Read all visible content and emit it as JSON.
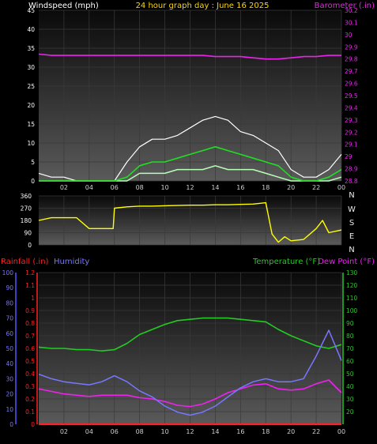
{
  "colors": {
    "background": "#000000",
    "wind": "#ffffff",
    "wind_avg": "#22dd22",
    "wind_low": "#b8ffb8",
    "barometer": "#ee22ee",
    "direction": "#ffff00",
    "temperature": "#22cc22",
    "dewpoint": "#ee22ee",
    "humidity": "#7777ff",
    "rainfall": "#ff2222",
    "title": "#ffd700"
  },
  "chart_data": [
    {
      "type": "line",
      "title": "24 hour graph day : June 16 2025",
      "left_label": "Windspeed (mph)",
      "right_label": "Barometer (.in)",
      "x_ticks": [
        "02",
        "04",
        "06",
        "08",
        "10",
        "12",
        "14",
        "16",
        "18",
        "20",
        "22",
        "00"
      ],
      "y_left": {
        "ticks": [
          0,
          5,
          10,
          15,
          20,
          25,
          30,
          35,
          40,
          45
        ],
        "range": [
          0,
          45
        ]
      },
      "y_right": {
        "ticks": [
          "28.8",
          "28.9",
          "29",
          "29.1",
          "29.2",
          "29.3",
          "29.4",
          "29.5",
          "29.6",
          "29.7",
          "29.8",
          "29.9",
          "30",
          "30.1",
          "30.2"
        ],
        "range": [
          28.8,
          30.2
        ]
      },
      "x_hours": [
        0,
        1,
        2,
        3,
        4,
        5,
        6,
        7,
        8,
        9,
        10,
        11,
        12,
        13,
        14,
        15,
        16,
        17,
        18,
        19,
        20,
        21,
        22,
        23,
        24
      ],
      "series": [
        {
          "name": "wind_gust",
          "values": [
            2,
            1,
            1,
            0,
            0,
            0,
            0,
            5,
            9,
            11,
            11,
            12,
            14,
            16,
            17,
            16,
            13,
            12,
            10,
            8,
            3,
            1,
            1,
            3,
            7
          ]
        },
        {
          "name": "wind_avg",
          "values": [
            0,
            0,
            0,
            0,
            0,
            0,
            0,
            1,
            4,
            5,
            5,
            6,
            7,
            8,
            9,
            8,
            7,
            6,
            5,
            4,
            1,
            0,
            0,
            1,
            3
          ]
        },
        {
          "name": "wind_low",
          "values": [
            0,
            0,
            0,
            0,
            0,
            0,
            0,
            0,
            2,
            2,
            2,
            3,
            3,
            3,
            4,
            3,
            3,
            3,
            2,
            1,
            0,
            0,
            0,
            0,
            1
          ]
        },
        {
          "name": "barometer",
          "values": [
            29.84,
            29.83,
            29.83,
            29.83,
            29.83,
            29.83,
            29.83,
            29.83,
            29.83,
            29.83,
            29.83,
            29.83,
            29.83,
            29.83,
            29.82,
            29.82,
            29.82,
            29.81,
            29.8,
            29.8,
            29.81,
            29.82,
            29.82,
            29.83,
            29.83
          ]
        }
      ]
    },
    {
      "type": "line",
      "compass_labels": [
        "N",
        "W",
        "S",
        "E",
        "N"
      ],
      "y_left": {
        "ticks": [
          0,
          90,
          180,
          270,
          360
        ],
        "range": [
          0,
          360
        ]
      },
      "x_hours": [
        0,
        1,
        2,
        3,
        4,
        5,
        5.9,
        6,
        7,
        8,
        9,
        10,
        11,
        12,
        13,
        14,
        15,
        16,
        17,
        18,
        18.5,
        19,
        19.5,
        20,
        21,
        22,
        22.5,
        23,
        23.5,
        24
      ],
      "series": [
        {
          "name": "wind_direction",
          "values": [
            180,
            200,
            200,
            200,
            120,
            120,
            120,
            270,
            280,
            285,
            285,
            288,
            290,
            292,
            292,
            295,
            295,
            298,
            300,
            310,
            80,
            20,
            60,
            30,
            40,
            120,
            180,
            90,
            100,
            110
          ]
        }
      ]
    },
    {
      "type": "line",
      "left_label_1": "Rainfall (.in)",
      "left_label_2": "Humidity",
      "right_label_1": "Temperature (°F)",
      "right_label_2": "Dew Point (°F)",
      "y_rain": {
        "ticks": [
          "0",
          "0.1",
          "0.2",
          "0.3",
          "0.4",
          "0.5",
          "0.6",
          "0.7",
          "0.8",
          "0.9",
          "1",
          "1.1",
          "1.2"
        ],
        "range": [
          0,
          1.2
        ]
      },
      "y_humidity": {
        "ticks": [
          0,
          10,
          20,
          30,
          40,
          50,
          60,
          70,
          80,
          90,
          100
        ],
        "range": [
          0,
          100
        ]
      },
      "y_right": {
        "ticks": [
          20,
          30,
          40,
          50,
          60,
          70,
          80,
          90,
          100,
          110,
          120,
          130
        ],
        "range": [
          10,
          130
        ]
      },
      "x_hours": [
        0,
        1,
        2,
        3,
        4,
        5,
        6,
        7,
        8,
        9,
        10,
        11,
        12,
        13,
        14,
        15,
        16,
        17,
        18,
        19,
        20,
        21,
        22,
        23,
        24
      ],
      "series": [
        {
          "name": "temperature",
          "values": [
            71,
            70,
            70,
            69,
            69,
            68,
            69,
            74,
            81,
            85,
            89,
            92,
            93,
            94,
            94,
            94,
            93,
            92,
            91,
            85,
            80,
            76,
            72,
            70,
            73
          ]
        },
        {
          "name": "dewpoint",
          "values": [
            38,
            36,
            34,
            33,
            32,
            33,
            33,
            33,
            31,
            30,
            28,
            25,
            24,
            26,
            30,
            35,
            38,
            41,
            42,
            38,
            37,
            38,
            42,
            45,
            35
          ]
        },
        {
          "name": "humidity",
          "values": [
            33,
            30,
            28,
            27,
            26,
            28,
            32,
            28,
            22,
            18,
            12,
            8,
            6,
            8,
            12,
            18,
            24,
            28,
            30,
            28,
            28,
            30,
            45,
            62,
            42
          ]
        },
        {
          "name": "rainfall",
          "values": [
            0,
            0,
            0,
            0,
            0,
            0,
            0,
            0,
            0,
            0,
            0,
            0,
            0,
            0,
            0,
            0,
            0,
            0,
            0,
            0,
            0,
            0,
            0,
            0,
            0
          ]
        }
      ]
    }
  ]
}
